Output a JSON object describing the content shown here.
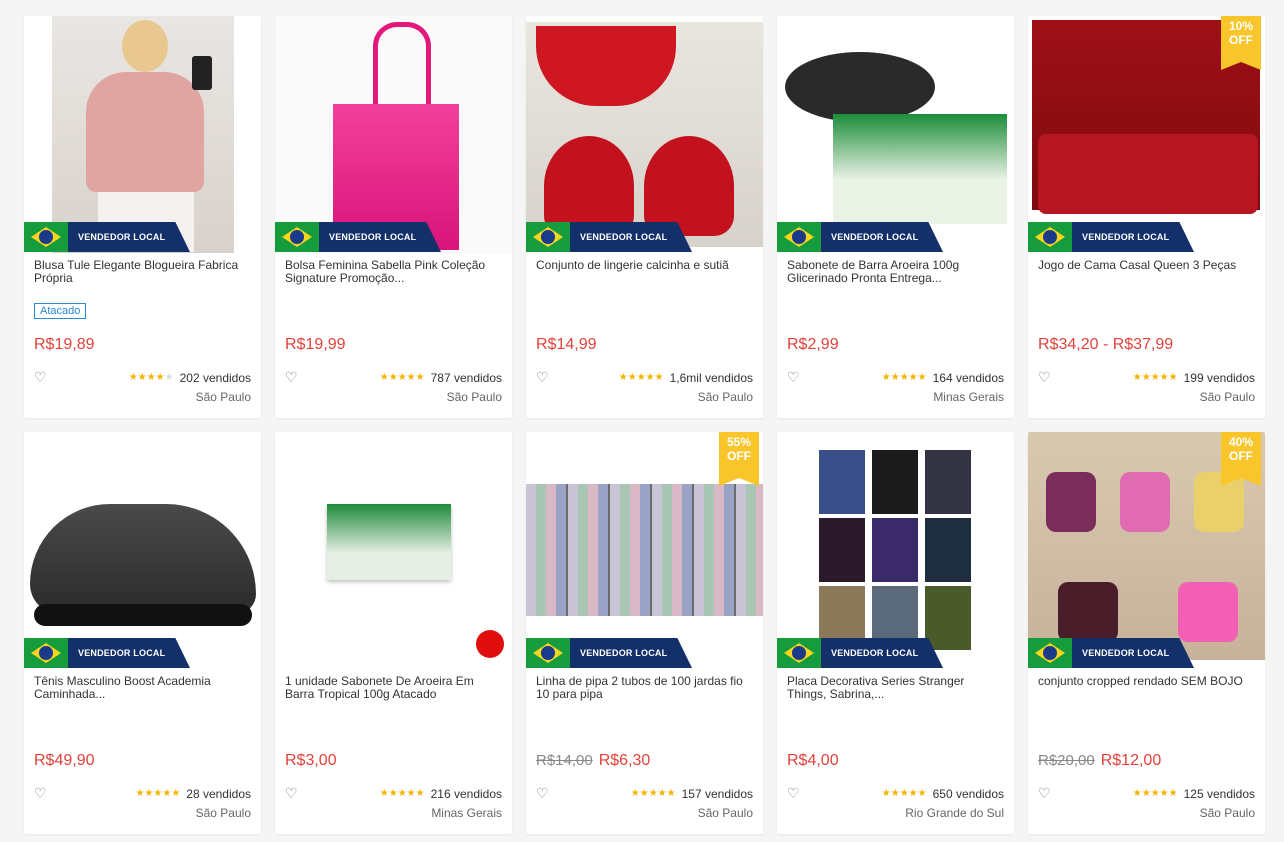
{
  "seller_badge": "VENDEDOR LOCAL",
  "discount_suffix": "OFF",
  "colors": {
    "price": "#e3413a",
    "star": "#f4b400",
    "badge_bg": "#13306b",
    "discount": "#f8c52a"
  },
  "products": [
    {
      "title": "Blusa Tule Elegante Blogueira Fabrica Própria",
      "tag": "Atacado",
      "price": "R$19,89",
      "old_price": "",
      "rating": 4,
      "sold": "202 vendidos",
      "location": "São Paulo",
      "discount": "",
      "image": "pink-blouse"
    },
    {
      "title": "Bolsa Feminina Sabella Pink Coleção Signature Promoção...",
      "tag": "",
      "price": "R$19,99",
      "old_price": "",
      "rating": 5,
      "sold": "787 vendidos",
      "location": "São Paulo",
      "discount": "",
      "image": "pink-bag"
    },
    {
      "title": "Conjunto de lingerie calcinha e sutiã",
      "tag": "",
      "price": "R$14,99",
      "old_price": "",
      "rating": 5,
      "sold": "1,6mil vendidos",
      "location": "São Paulo",
      "discount": "",
      "image": "red-lingerie"
    },
    {
      "title": "Sabonete de Barra Aroeira 100g Glicerinado Pronta Entrega...",
      "tag": "",
      "price": "R$2,99",
      "old_price": "",
      "rating": 5,
      "sold": "164 vendidos",
      "location": "Minas Gerais",
      "discount": "",
      "image": "soap-box"
    },
    {
      "title": "Jogo de Cama Casal Queen 3 Peças",
      "tag": "",
      "price": "R$34,20 - R$37,99",
      "old_price": "",
      "rating": 5,
      "sold": "199 vendidos",
      "location": "São Paulo",
      "discount": "10%",
      "image": "red-bedding"
    },
    {
      "title": "Tênis Masculino Boost Academia Caminhada...",
      "tag": "",
      "price": "R$49,90",
      "old_price": "",
      "rating": 5,
      "sold": "28 vendidos",
      "location": "São Paulo",
      "discount": "",
      "image": "black-sneaker"
    },
    {
      "title": "1 unidade Sabonete De Aroeira Em Barra Tropical 100g Atacado",
      "tag": "",
      "price": "R$3,00",
      "old_price": "",
      "rating": 5,
      "sold": "216 vendidos",
      "location": "Minas Gerais",
      "discount": "",
      "image": "soap-small"
    },
    {
      "title": "Linha de pipa 2 tubos de 100 jardas fio 10 para pipa",
      "tag": "",
      "price": "R$6,30",
      "old_price": "R$14,00",
      "rating": 5,
      "sold": "157 vendidos",
      "location": "São Paulo",
      "discount": "55%",
      "image": "thread-spools"
    },
    {
      "title": "Placa Decorativa Series Stranger Things, Sabrina,...",
      "tag": "",
      "price": "R$4,00",
      "old_price": "",
      "rating": 5,
      "sold": "650 vendidos",
      "location": "Rio Grande do Sul",
      "discount": "",
      "image": "poster-grid"
    },
    {
      "title": "conjunto cropped rendado SEM BOJO",
      "tag": "",
      "price": "R$12,00",
      "old_price": "R$20,00",
      "rating": 5,
      "sold": "125 vendidos",
      "location": "São Paulo",
      "discount": "40%",
      "image": "cropped-set"
    }
  ]
}
